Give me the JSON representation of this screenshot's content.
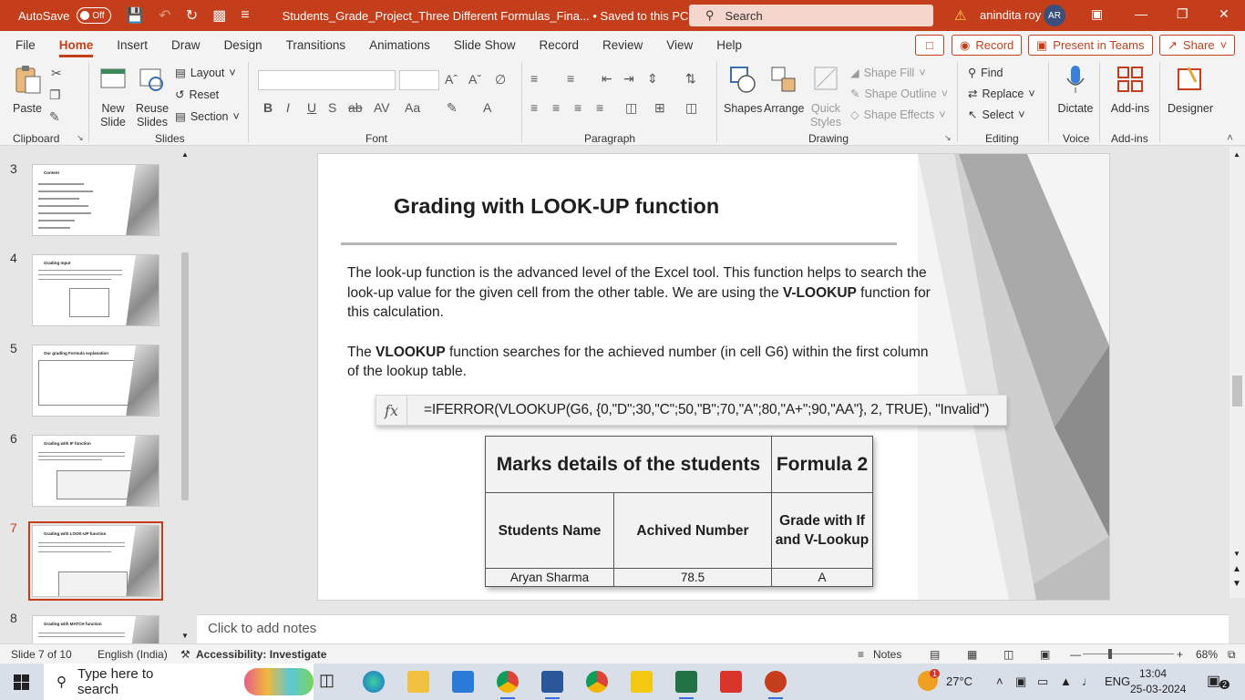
{
  "titlebar": {
    "autosave_label": "AutoSave",
    "autosave_state": "Off",
    "doc_title": "Students_Grade_Project_Three Different Formulas_Fina... • Saved to this PC",
    "search_placeholder": "Search",
    "user_name": "anindita roy",
    "user_initials": "AR"
  },
  "tabs": [
    "File",
    "Home",
    "Insert",
    "Draw",
    "Design",
    "Transitions",
    "Animations",
    "Slide Show",
    "Record",
    "Review",
    "View",
    "Help"
  ],
  "ribbon_buttons": {
    "record": "Record",
    "present_teams": "Present in Teams",
    "share": "Share"
  },
  "ribbon": {
    "clipboard": {
      "label": "Clipboard",
      "paste": "Paste"
    },
    "slides": {
      "label": "Slides",
      "new_slide": "New Slide",
      "reuse": "Reuse Slides",
      "layout": "Layout",
      "reset": "Reset",
      "section": "Section"
    },
    "font": {
      "label": "Font"
    },
    "paragraph": {
      "label": "Paragraph"
    },
    "drawing": {
      "label": "Drawing",
      "shapes": "Shapes",
      "arrange": "Arrange",
      "quick_styles": "Quick Styles",
      "shape_fill": "Shape Fill",
      "shape_outline": "Shape Outline",
      "shape_effects": "Shape Effects"
    },
    "editing": {
      "label": "Editing",
      "find": "Find",
      "replace": "Replace",
      "select": "Select"
    },
    "voice": {
      "label": "Voice",
      "dictate": "Dictate"
    },
    "addins": {
      "label": "Add-ins",
      "addins": "Add-ins"
    },
    "designer": {
      "designer": "Designer"
    }
  },
  "thumbnails": [
    {
      "num": "3",
      "title": "Content"
    },
    {
      "num": "4",
      "title": "Grading Input"
    },
    {
      "num": "5",
      "title": "Our grading Formula explanation"
    },
    {
      "num": "6",
      "title": "Grading with IF function"
    },
    {
      "num": "7",
      "title": "Grading with LOOK-UP function"
    },
    {
      "num": "8",
      "title": "Grading with MATCH function"
    }
  ],
  "slide": {
    "title": "Grading with LOOK-UP function",
    "p1_a": "The look-up function is the advanced level of the Excel tool. This function helps to search the look-up value for the given cell from the other table. We are using the ",
    "p1_b": "V-LOOKUP",
    "p1_c": " function for this calculation.",
    "p2_a": "The ",
    "p2_b": "VLOOKUP",
    "p2_c": " function searches for the achieved number (in cell G6) within the first column of the lookup table.",
    "formula": "=IFERROR(VLOOKUP(G6, {0,\"D\";30,\"C\";50,\"B\";70,\"A\";80,\"A+\";90,\"AA\"}, 2, TRUE), \"Invalid\")",
    "table": {
      "header1": "Marks details of the students",
      "header2": "Formula 2",
      "col1": "Students Name",
      "col2": "Achived Number",
      "col3": "Grade with If and V-Lookup",
      "rows": [
        [
          "Aryan Sharma",
          "78.5",
          "A"
        ]
      ]
    }
  },
  "notes_placeholder": "Click to add notes",
  "status": {
    "slide_pos": "Slide 7 of 10",
    "language": "English (India)",
    "accessibility": "Accessibility: Investigate",
    "notes": "Notes",
    "zoom": "68%"
  },
  "taskbar": {
    "search_placeholder": "Type here to search",
    "temperature": "27°C",
    "lang": "ENG",
    "time": "13:04",
    "date": "25-03-2024",
    "notif_count": "2",
    "weather_badge": "1"
  },
  "colors": {
    "accent": "#c43e1c",
    "taskbar": "#d9dfe9"
  }
}
